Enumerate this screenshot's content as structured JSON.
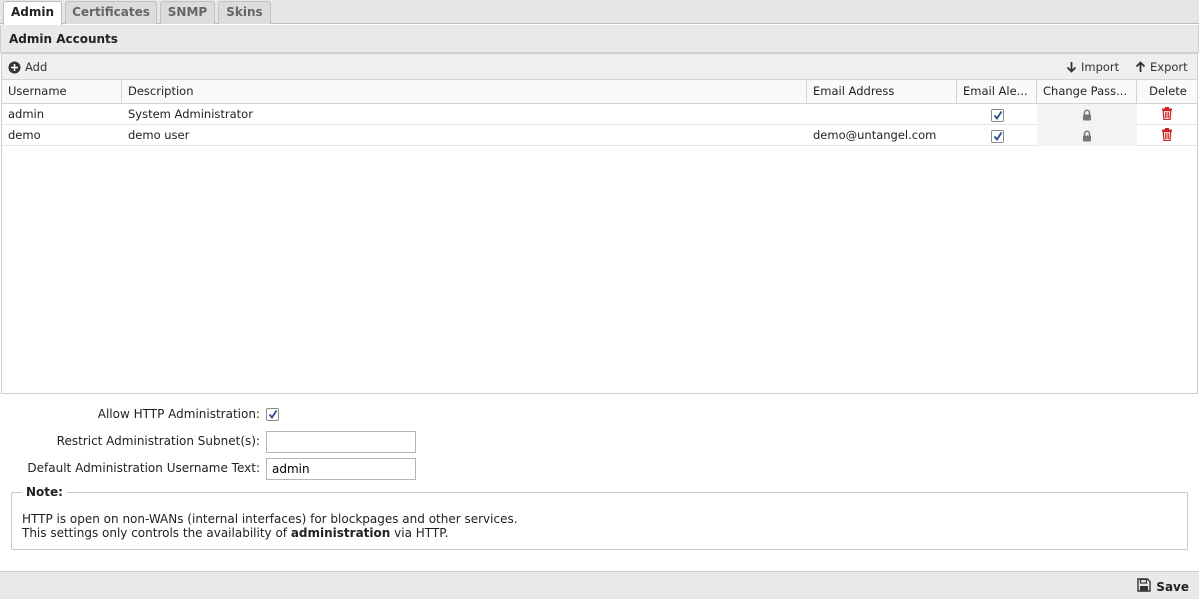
{
  "tabs": [
    {
      "label": "Admin",
      "active": true
    },
    {
      "label": "Certificates",
      "active": false
    },
    {
      "label": "SNMP",
      "active": false
    },
    {
      "label": "Skins",
      "active": false
    }
  ],
  "panel": {
    "title": "Admin Accounts"
  },
  "toolbar": {
    "add_label": "Add",
    "add_icon": "plus-circle-icon",
    "import_label": "Import",
    "import_icon": "arrow-down-icon",
    "export_label": "Export",
    "export_icon": "arrow-up-icon"
  },
  "columns": [
    "Username",
    "Description",
    "Email Address",
    "Email Ale...",
    "Change Pass...",
    "Delete"
  ],
  "rows": [
    {
      "username": "admin",
      "description": "System Administrator",
      "email": "",
      "email_alerts": true
    },
    {
      "username": "demo",
      "description": "demo user",
      "email": "demo@untangel.com",
      "email_alerts": true
    }
  ],
  "row_icons": {
    "change_password": "lock-icon",
    "delete": "trash-icon"
  },
  "form": {
    "allow_http_label": "Allow HTTP Administration:",
    "allow_http_checked": true,
    "restrict_subnet_label": "Restrict Administration Subnet(s):",
    "restrict_subnet_value": "",
    "default_username_label": "Default Administration Username Text:",
    "default_username_value": "admin"
  },
  "note": {
    "legend": "Note:",
    "line1": "HTTP is open on non-WANs (internal interfaces) for blockpages and other services.",
    "line2_prefix": "This settings only controls the availability of ",
    "line2_bold": "administration",
    "line2_suffix": " via HTTP."
  },
  "footer": {
    "save_label": "Save",
    "save_icon": "floppy-disk-icon"
  },
  "colors": {
    "delete_red": "#cc2222",
    "checkbox_blue": "#2a4e8c"
  }
}
